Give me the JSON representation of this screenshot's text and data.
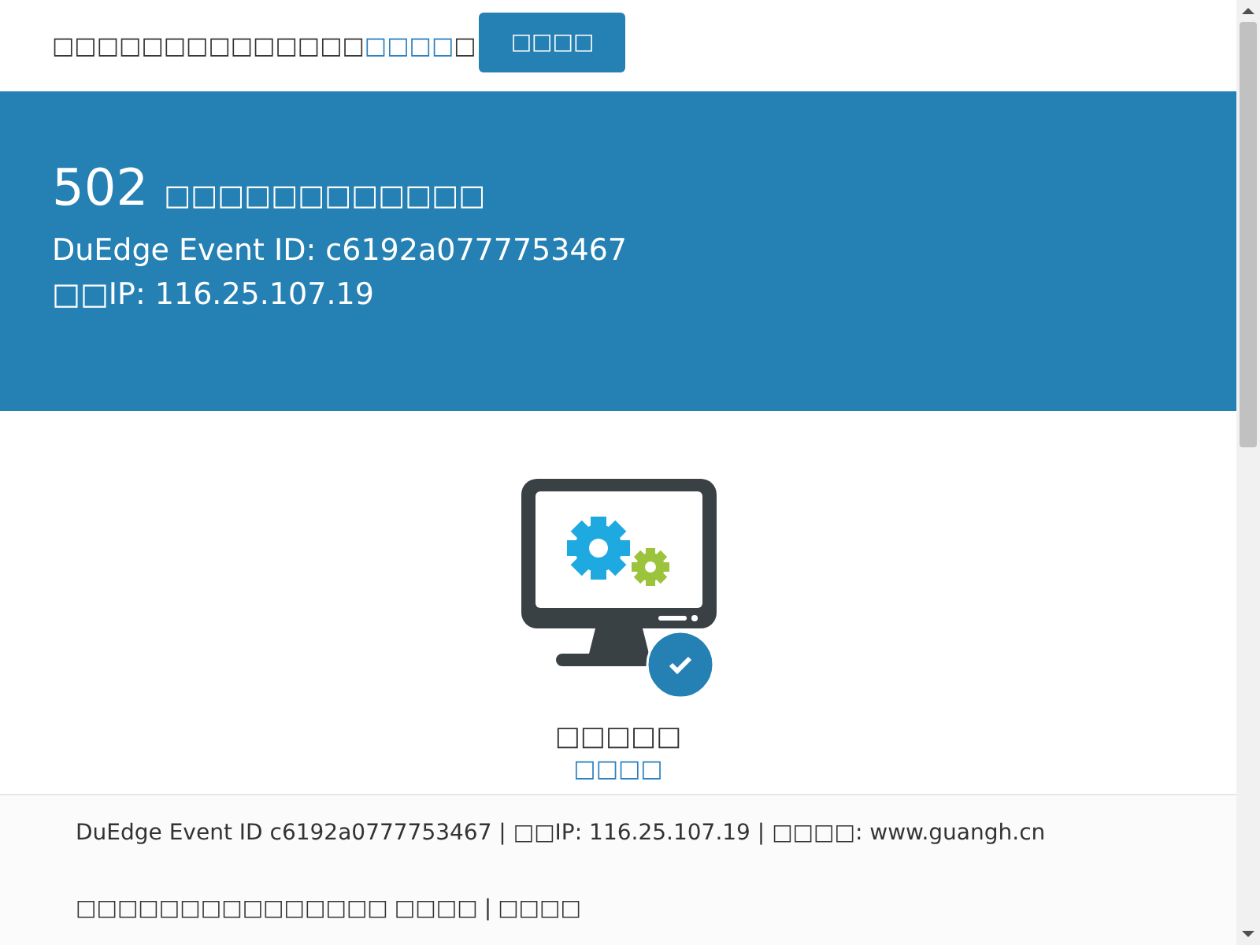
{
  "notice": {
    "text": "□□□□□□□□□□□□□□",
    "link": "□□□□",
    "after": "□",
    "button": "□□□□"
  },
  "banner": {
    "code": "502",
    "message": "□□□□□□□□□□□□",
    "event_id": "DuEdge Event ID: c6192a0777753467",
    "ip": "□□IP: 116.25.107.19"
  },
  "status": {
    "title": "□□□□□",
    "link": "□□□□"
  },
  "footer": {
    "line": "DuEdge Event ID c6192a0777753467 | □□IP: 116.25.107.19 | □□□□: www.guangh.cn",
    "note": "□□□□□□□□□□□□□□□",
    "links": [
      "□□□□",
      "□□□□"
    ],
    "separator": "|"
  }
}
